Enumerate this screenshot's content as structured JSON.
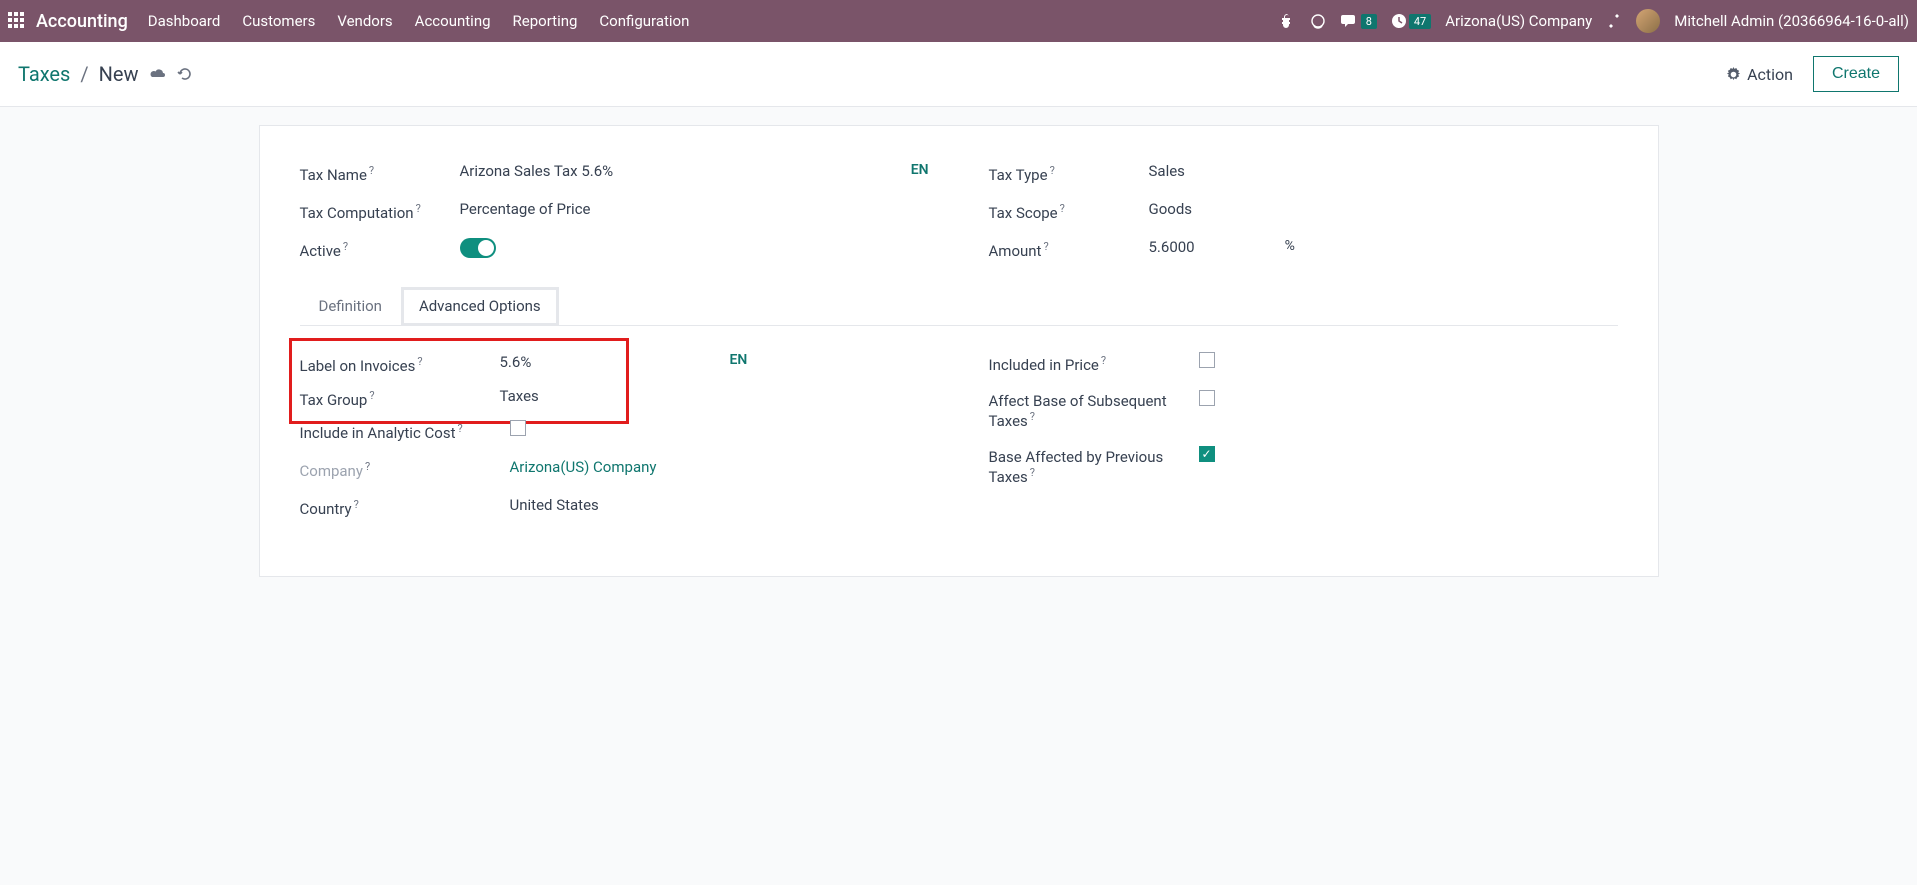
{
  "nav": {
    "brand": "Accounting",
    "items": [
      "Dashboard",
      "Customers",
      "Vendors",
      "Accounting",
      "Reporting",
      "Configuration"
    ],
    "messages_badge": "8",
    "activities_badge": "47",
    "company": "Arizona(US) Company",
    "user": "Mitchell Admin (20366964-16-0-all)"
  },
  "breadcrumb": {
    "parent": "Taxes",
    "current": "New",
    "action_label": "Action",
    "create_label": "Create"
  },
  "form": {
    "tax_name_label": "Tax Name",
    "tax_name_value": "Arizona Sales Tax 5.6%",
    "lang": "EN",
    "tax_computation_label": "Tax Computation",
    "tax_computation_value": "Percentage of Price",
    "active_label": "Active",
    "tax_type_label": "Tax Type",
    "tax_type_value": "Sales",
    "tax_scope_label": "Tax Scope",
    "tax_scope_value": "Goods",
    "amount_label": "Amount",
    "amount_value": "5.6000",
    "amount_unit": "%"
  },
  "tabs": {
    "definition": "Definition",
    "advanced": "Advanced Options"
  },
  "advanced": {
    "label_invoices_label": "Label on Invoices",
    "label_invoices_value": "5.6%",
    "lang": "EN",
    "tax_group_label": "Tax Group",
    "tax_group_value": "Taxes",
    "include_analytic_label": "Include in Analytic Cost",
    "company_label": "Company",
    "company_value": "Arizona(US) Company",
    "country_label": "Country",
    "country_value": "United States",
    "included_price_label": "Included in Price",
    "affect_base_label": "Affect Base of Subsequent Taxes",
    "base_affected_label": "Base Affected by Previous Taxes"
  }
}
